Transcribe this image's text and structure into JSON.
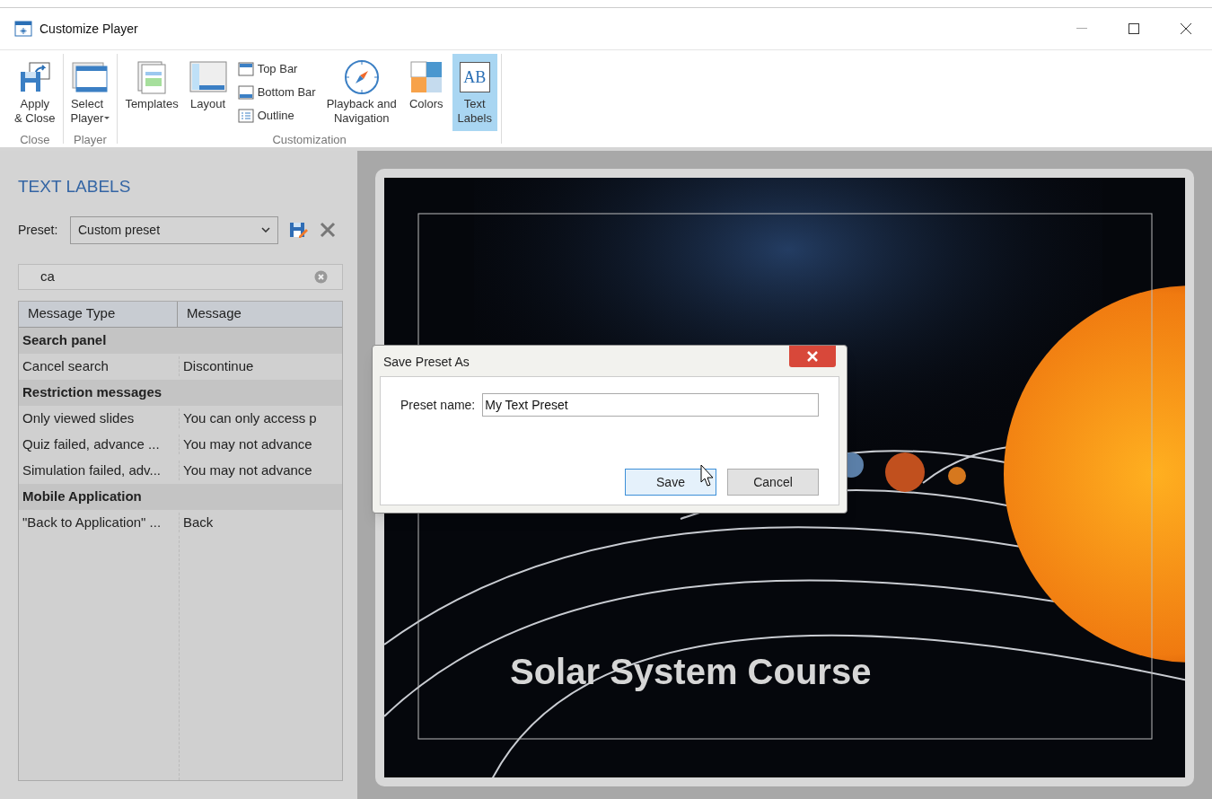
{
  "window": {
    "title": "Customize Player"
  },
  "ribbon": {
    "groups": [
      {
        "label": "Close",
        "items": [
          {
            "kind": "large",
            "label": [
              "Apply",
              "& Close"
            ],
            "selected": false
          }
        ]
      },
      {
        "label": "Player",
        "items": [
          {
            "kind": "large",
            "label": [
              "Select",
              "Player"
            ],
            "dropdown": true,
            "selected": false
          }
        ]
      },
      {
        "label": "Customization",
        "items": [
          {
            "kind": "large",
            "label": [
              "Templates"
            ],
            "selected": false
          },
          {
            "kind": "large",
            "label": [
              "Layout"
            ],
            "selected": false
          },
          {
            "kind": "small",
            "label": "Top Bar",
            "selected": false
          },
          {
            "kind": "small",
            "label": "Bottom Bar",
            "selected": false
          },
          {
            "kind": "small",
            "label": "Outline",
            "selected": false
          },
          {
            "kind": "large",
            "label": [
              "Playback and",
              "Navigation"
            ],
            "selected": false
          },
          {
            "kind": "large",
            "label": [
              "Colors"
            ],
            "selected": false
          },
          {
            "kind": "large",
            "label": [
              "Text",
              "Labels"
            ],
            "icon_text": "AB",
            "selected": true
          }
        ]
      }
    ]
  },
  "panel": {
    "title": "TEXT LABELS",
    "preset_label": "Preset:",
    "preset_value": "Custom preset",
    "search_value": "ca",
    "table": {
      "columns": [
        "Message Type",
        "Message"
      ],
      "rows": [
        {
          "kind": "group",
          "cells": [
            "Search panel"
          ]
        },
        {
          "kind": "item",
          "cells": [
            "Cancel search",
            "Discontinue"
          ]
        },
        {
          "kind": "group",
          "cells": [
            "Restriction messages"
          ]
        },
        {
          "kind": "item",
          "cells": [
            "Only viewed slides",
            "You can only access p"
          ]
        },
        {
          "kind": "item",
          "cells": [
            "Quiz failed, advance ...",
            "You may not advance"
          ]
        },
        {
          "kind": "item",
          "cells": [
            "Simulation failed, adv...",
            "You may not advance"
          ]
        },
        {
          "kind": "group",
          "cells": [
            "Mobile Application"
          ]
        },
        {
          "kind": "item",
          "cells": [
            "\"Back to Application\" ...",
            "Back"
          ]
        }
      ]
    }
  },
  "slide": {
    "title": "Solar System Course"
  },
  "dialog": {
    "title": "Save Preset As",
    "field_label": "Preset name:",
    "field_value": "My Text Preset",
    "buttons": [
      {
        "label": "Save",
        "default": true
      },
      {
        "label": "Cancel",
        "default": false
      }
    ]
  }
}
